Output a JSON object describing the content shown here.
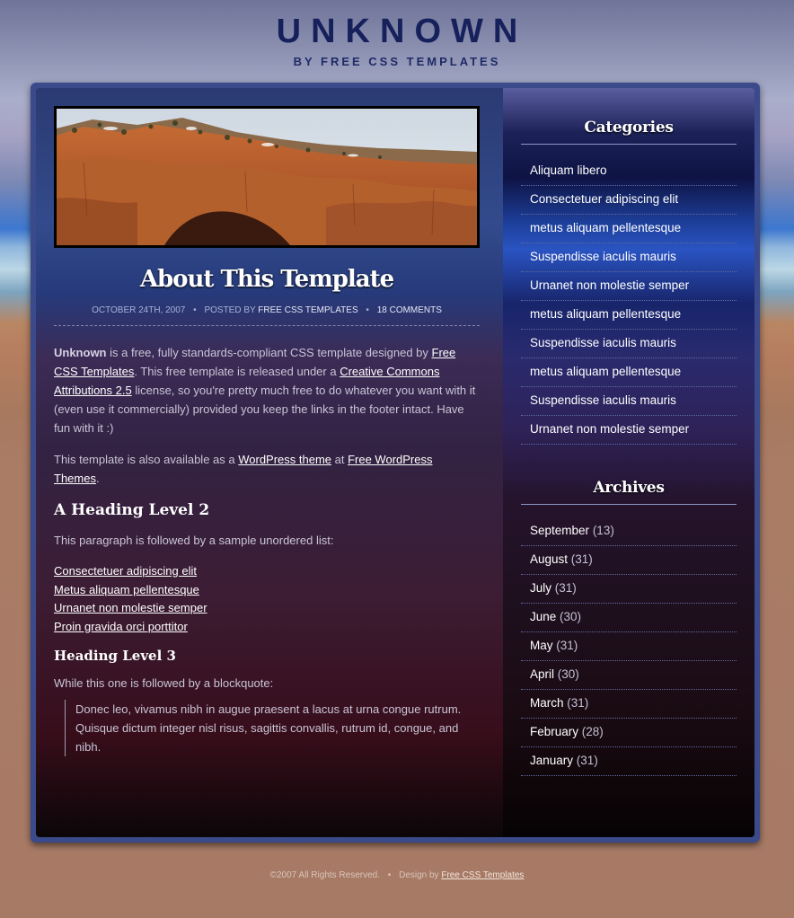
{
  "header": {
    "site_title": "UNKNOWN",
    "subtitle": "BY FREE CSS TEMPLATES"
  },
  "post": {
    "title": "About This Template",
    "date": "OCTOBER 24TH, 2007",
    "posted_by_prefix": "POSTED BY",
    "author": "FREE CSS TEMPLATES",
    "comments": "18 COMMENTS",
    "meta_separator": "•",
    "p1": {
      "strong": "Unknown",
      "t1": " is a free, fully standards-compliant CSS template designed by ",
      "link1": "Free CSS Templates",
      "t2": ". This free template is released under a ",
      "link2": "Creative Commons Attributions 2.5",
      "t3": " license, so you're pretty much free to do whatever you want with it (even use it commercially) provided you keep the links in the footer intact. Have fun with it :)"
    },
    "p2": {
      "t1": "This template is also available as a ",
      "link1": "WordPress theme",
      "t2": " at ",
      "link2": "Free WordPress Themes",
      "t3": "."
    },
    "h2": "A Heading Level 2",
    "p3": "This paragraph is followed by a sample unordered list:",
    "list": [
      "Consectetuer adipiscing elit",
      "Metus aliquam pellentesque",
      "Urnanet non molestie semper",
      "Proin gravida orci porttitor"
    ],
    "h3": "Heading Level 3",
    "p4": "While this one is followed by a blockquote:",
    "blockquote": "Donec leo, vivamus nibh in augue praesent a lacus at urna congue rutrum. Quisque dictum integer nisl risus, sagittis convallis, rutrum id, congue, and nibh."
  },
  "sidebar": {
    "categories_title": "Categories",
    "categories": [
      "Aliquam libero",
      "Consectetuer adipiscing elit",
      "metus aliquam pellentesque",
      "Suspendisse iaculis mauris",
      "Urnanet non molestie semper",
      "metus aliquam pellentesque",
      "Suspendisse iaculis mauris",
      "metus aliquam pellentesque",
      "Suspendisse iaculis mauris",
      "Urnanet non molestie semper"
    ],
    "archives_title": "Archives",
    "archives": [
      {
        "month": "September",
        "count": "(13)"
      },
      {
        "month": "August",
        "count": "(31)"
      },
      {
        "month": "July",
        "count": "(31)"
      },
      {
        "month": "June",
        "count": "(30)"
      },
      {
        "month": "May",
        "count": "(31)"
      },
      {
        "month": "April",
        "count": "(30)"
      },
      {
        "month": "March",
        "count": "(31)"
      },
      {
        "month": "February",
        "count": "(28)"
      },
      {
        "month": "January",
        "count": "(31)"
      }
    ]
  },
  "footer": {
    "copyright": "©2007 All Rights Reserved.",
    "separator": "•",
    "design_prefix": "Design by",
    "design_link": "Free CSS Templates"
  },
  "colors": {
    "title": "#16205b",
    "link": "#ffffff",
    "body_text": "#c9c5d6"
  }
}
